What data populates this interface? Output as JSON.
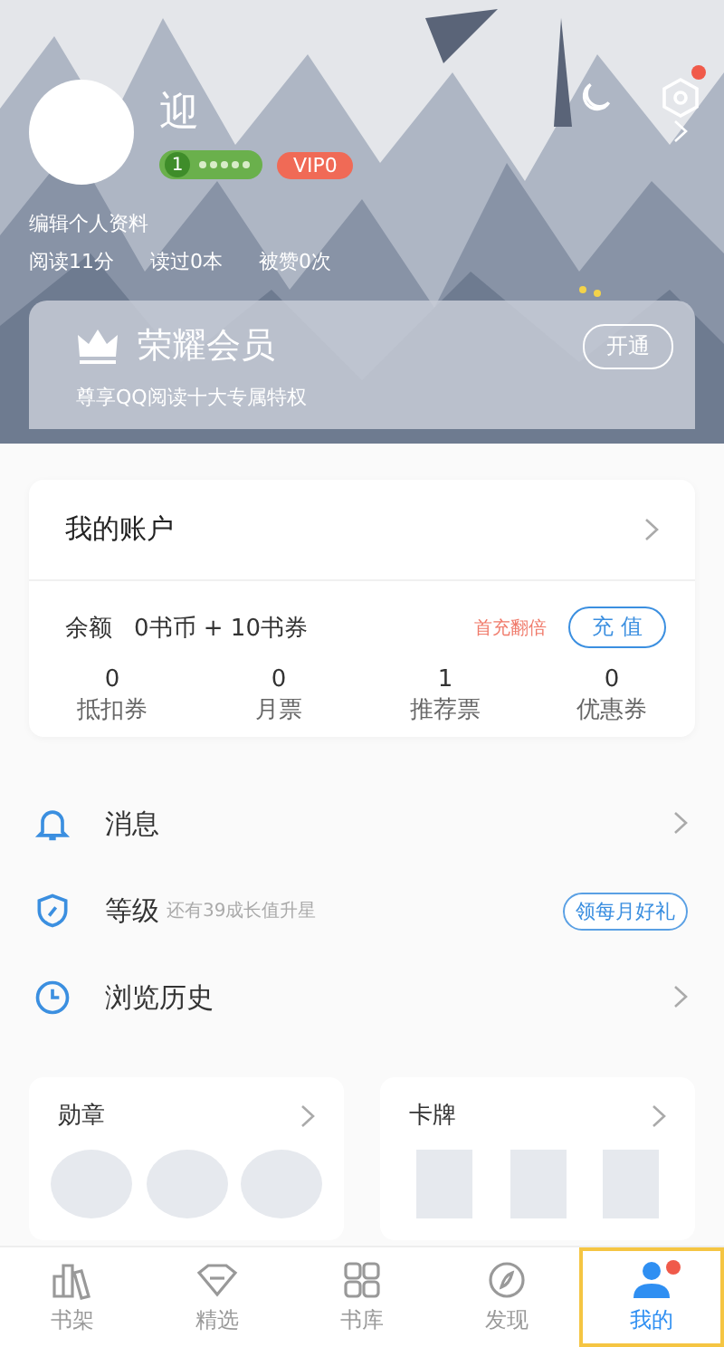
{
  "profile": {
    "name": "迎",
    "level": "1",
    "vip": "VIP0",
    "edit_link": "编辑个人资料",
    "stats": [
      "阅读11分",
      "读过0本",
      "被赞0次"
    ],
    "settings_badge": true
  },
  "membership": {
    "title": "荣耀会员",
    "subtitle": "尊享QQ阅读十大专属特权",
    "button": "开通"
  },
  "account": {
    "title": "我的账户",
    "balance_label": "余额",
    "balance": "0书币 + 10书券",
    "promo": "首充翻倍",
    "recharge": "充 值",
    "counters": [
      {
        "value": "0",
        "label": "抵扣券"
      },
      {
        "value": "0",
        "label": "月票"
      },
      {
        "value": "1",
        "label": "推荐票"
      },
      {
        "value": "0",
        "label": "优惠券"
      }
    ]
  },
  "menu": [
    {
      "kind": "bell",
      "label": "消息"
    },
    {
      "kind": "shield",
      "label": "等级",
      "hint": "还有39成长值升星",
      "action": "领每月好礼"
    },
    {
      "kind": "clock",
      "label": "浏览历史"
    }
  ],
  "collections": [
    {
      "kind": "badges",
      "title": "勋章"
    },
    {
      "kind": "cards",
      "title": "卡牌"
    }
  ],
  "tabs": [
    {
      "kind": "shelf",
      "label": "书架",
      "selected": false,
      "dot": false
    },
    {
      "kind": "gem",
      "label": "精选",
      "selected": false,
      "dot": false
    },
    {
      "kind": "grid",
      "label": "书库",
      "selected": false,
      "dot": false
    },
    {
      "kind": "compass",
      "label": "发现",
      "selected": false,
      "dot": false
    },
    {
      "kind": "person",
      "label": "我的",
      "selected": true,
      "dot": true
    }
  ]
}
